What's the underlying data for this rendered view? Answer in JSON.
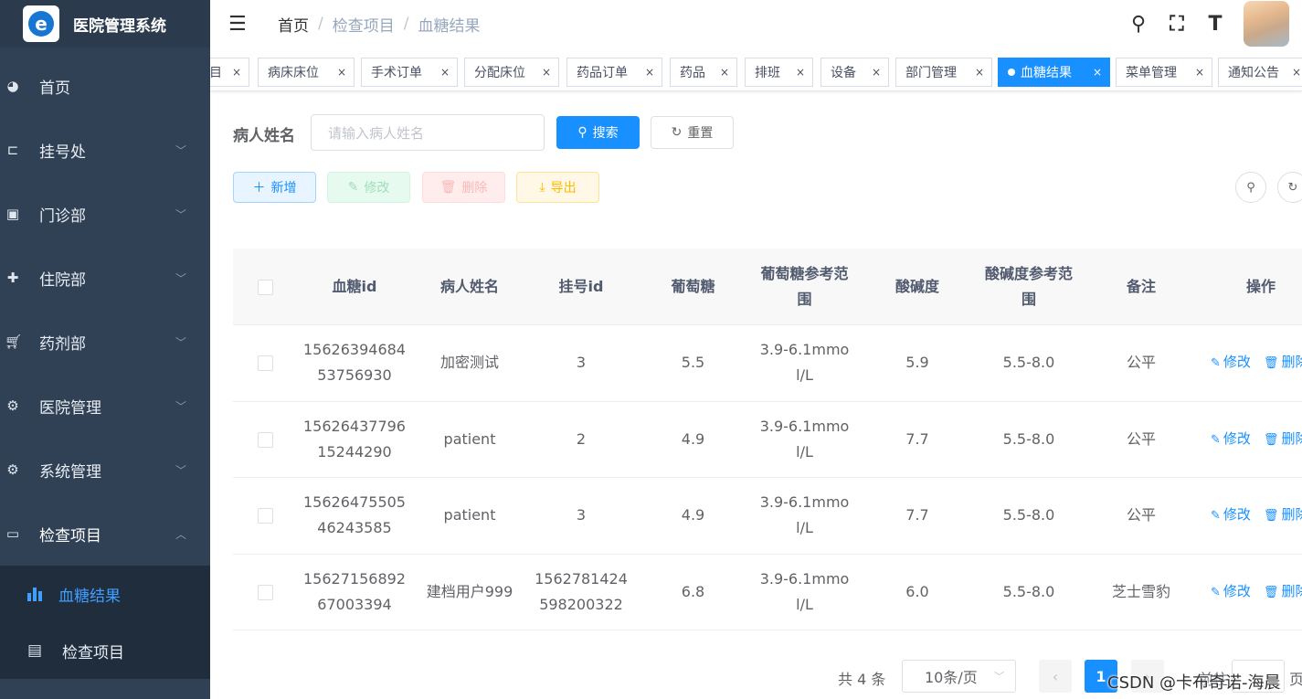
{
  "app": {
    "title": "医院管理系统",
    "logo_letter": "e"
  },
  "sidebar": {
    "items": [
      {
        "label": "首页",
        "icon": "dashboard-icon"
      },
      {
        "label": "挂号处",
        "icon": "registration-icon"
      },
      {
        "label": "门诊部",
        "icon": "clinic-icon"
      },
      {
        "label": "住院部",
        "icon": "hospital-icon"
      },
      {
        "label": "药剂部",
        "icon": "cart-icon"
      },
      {
        "label": "医院管理",
        "icon": "gear-icon"
      },
      {
        "label": "系统管理",
        "icon": "gear-icon"
      },
      {
        "label": "检查项目",
        "icon": "briefcase-icon"
      }
    ],
    "submenu": [
      {
        "label": "血糖结果",
        "icon": "bar-chart-icon"
      },
      {
        "label": "检查项目",
        "icon": "document-icon"
      }
    ]
  },
  "breadcrumb": [
    "首页",
    "检查项目",
    "血糖结果"
  ],
  "tags": [
    {
      "label": "目"
    },
    {
      "label": "病床床位"
    },
    {
      "label": "手术订单"
    },
    {
      "label": "分配床位"
    },
    {
      "label": "药品订单"
    },
    {
      "label": "药品"
    },
    {
      "label": "排班"
    },
    {
      "label": "设备"
    },
    {
      "label": "部门管理"
    },
    {
      "label": "血糖结果"
    },
    {
      "label": "菜单管理"
    },
    {
      "label": "通知公告"
    }
  ],
  "search": {
    "label": "病人姓名",
    "placeholder": "请输入病人姓名",
    "search_button": "搜索",
    "reset_button": "重置"
  },
  "toolbar": {
    "add": "新增",
    "edit": "修改",
    "delete": "删除",
    "export": "导出"
  },
  "table": {
    "headers": [
      "血糖id",
      "病人姓名",
      "挂号id",
      "葡萄糖",
      "葡萄糖参考范围",
      "酸碱度",
      "酸碱度参考范围",
      "备注",
      "操作"
    ],
    "rows": [
      {
        "id": "1562639468453756930",
        "name": "加密测试",
        "reg": "3",
        "glucose": "5.5",
        "glucose_range": "3.9-6.1mmol/L",
        "ph": "5.9",
        "ph_range": "5.5-8.0",
        "note": "公平"
      },
      {
        "id": "1562643779615244290",
        "name": "patient",
        "reg": "2",
        "glucose": "4.9",
        "glucose_range": "3.9-6.1mmol/L",
        "ph": "7.7",
        "ph_range": "5.5-8.0",
        "note": "公平"
      },
      {
        "id": "1562647550546243585",
        "name": "patient",
        "reg": "3",
        "glucose": "4.9",
        "glucose_range": "3.9-6.1mmol/L",
        "ph": "7.7",
        "ph_range": "5.5-8.0",
        "note": "公平"
      },
      {
        "id": "1562715689267003394",
        "name": "建档用户999",
        "reg": "1562781424598200322",
        "glucose": "6.8",
        "glucose_range": "3.9-6.1mmol/L",
        "ph": "6.0",
        "ph_range": "5.5-8.0",
        "note": "芝士雪豹"
      }
    ],
    "op_edit": "修改",
    "op_delete": "删除"
  },
  "pagination": {
    "total": "共 4 条",
    "page_size": "10条/页",
    "current_page": "1",
    "goto": "前往",
    "page_unit": "页"
  },
  "watermark": "CSDN @卡布奇诺-海晨",
  "colors": {
    "primary": "#1890ff",
    "sidebar_bg": "#304156",
    "submenu_bg": "#1f2d3d"
  }
}
